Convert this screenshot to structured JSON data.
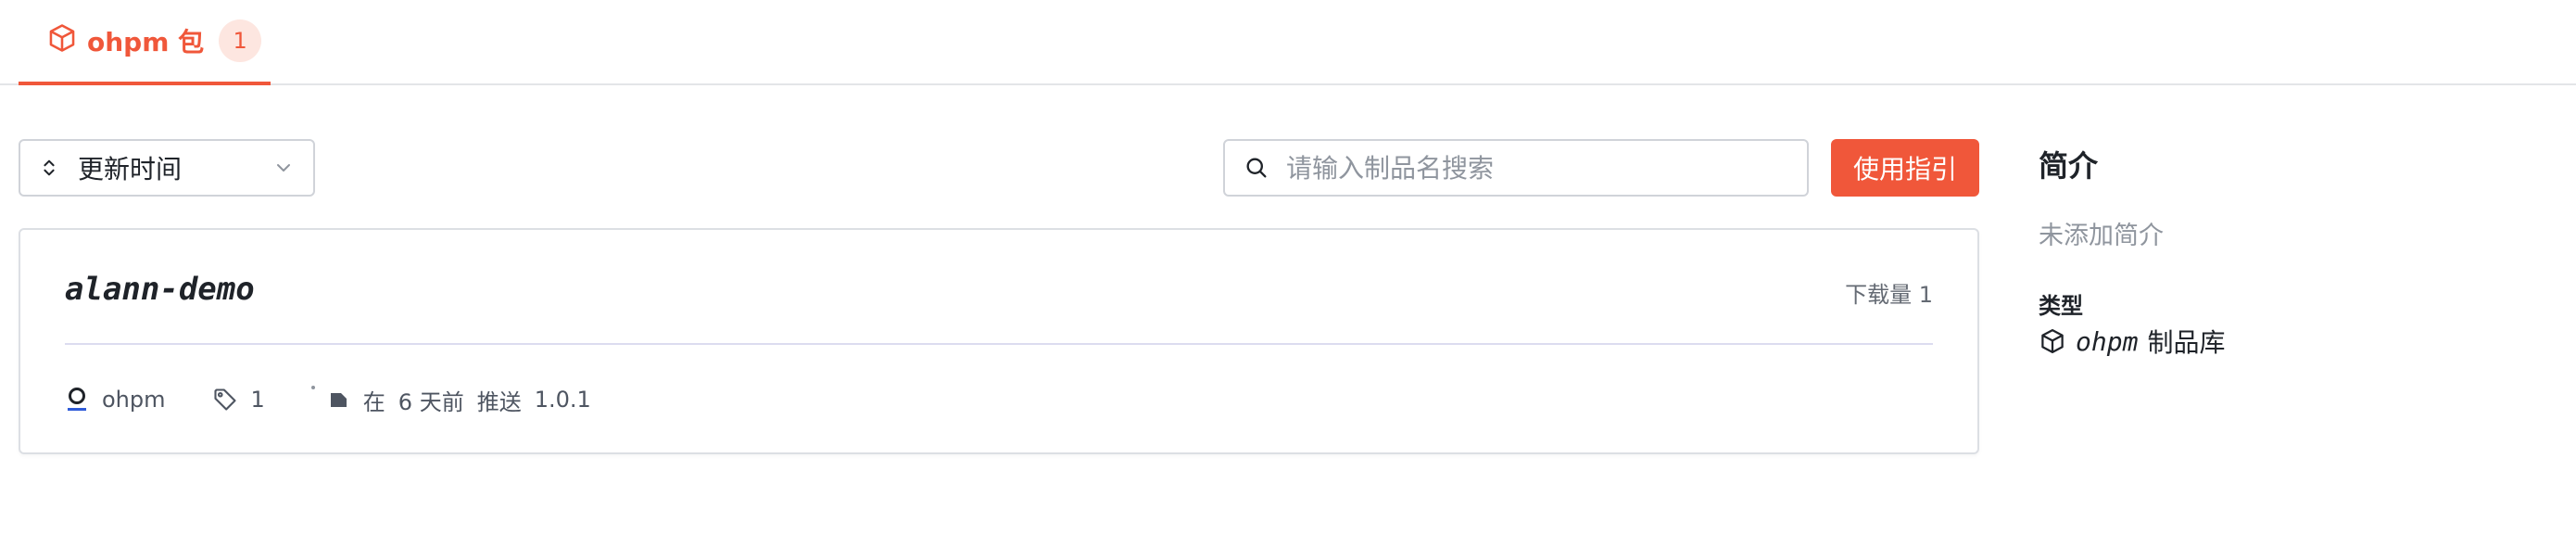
{
  "tabs": [
    {
      "label": "ohpm 包",
      "count": "1",
      "active": true,
      "icon": "package-icon"
    }
  ],
  "toolbar": {
    "sort_label": "更新时间",
    "search_placeholder": "请输入制品名搜索",
    "search_value": "",
    "guide_label": "使用指引"
  },
  "package": {
    "name": "alann-demo",
    "downloads": "下载量 1",
    "registry": "ohpm",
    "tags": "1",
    "push_prefix": "在",
    "push_time": "6 天前",
    "push_action": "推送",
    "version": "1.0.1"
  },
  "sidebar": {
    "title": "简介",
    "description": "未添加简介",
    "type_label": "类型",
    "type_name": "ohpm",
    "type_suffix": "制品库"
  },
  "colors": {
    "accent": "#f0573a",
    "accent_light": "#fde6e0",
    "text": "#1f2329",
    "muted": "#8f959e",
    "border": "#d0d3d9"
  }
}
